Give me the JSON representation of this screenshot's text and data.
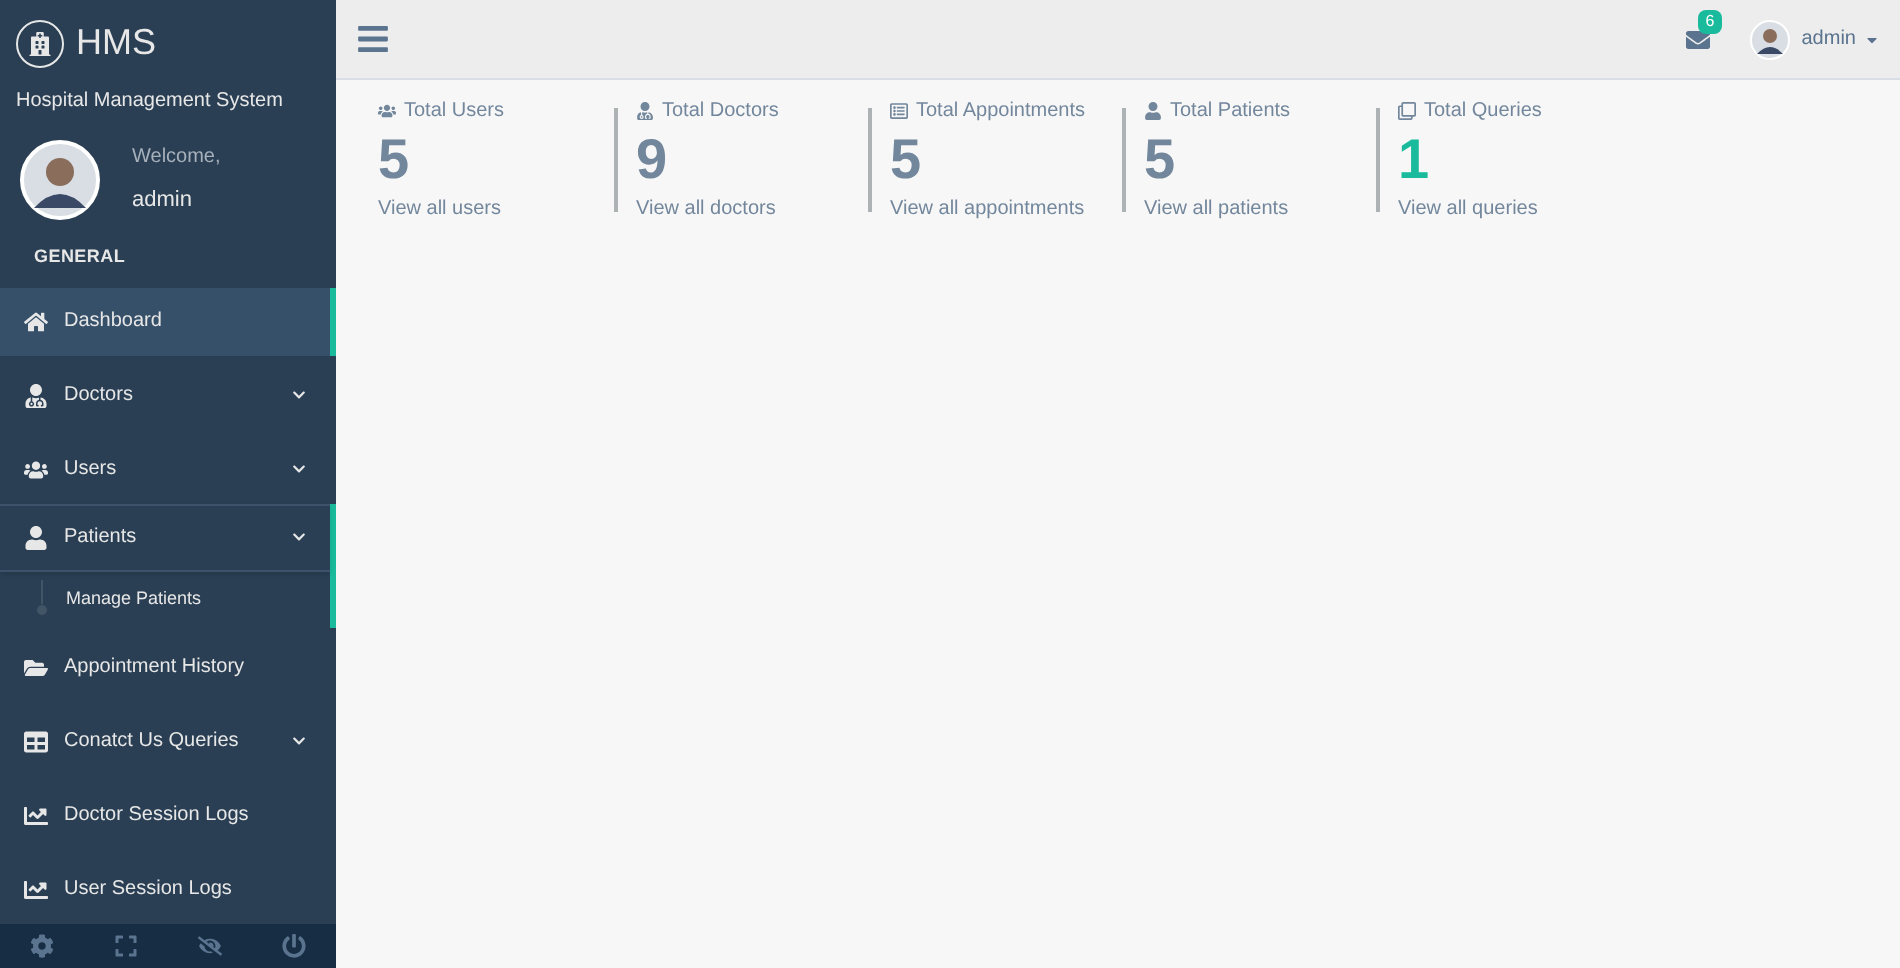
{
  "brand": {
    "title": "HMS",
    "subtitle": "Hospital Management System"
  },
  "profile": {
    "welcome": "Welcome,",
    "name": "admin"
  },
  "section_title": "GENERAL",
  "sidebar": {
    "items": [
      {
        "label": "Dashboard",
        "selected": true,
        "expandable": false,
        "expanded": false
      },
      {
        "label": "Doctors",
        "selected": false,
        "expandable": true,
        "expanded": false
      },
      {
        "label": "Users",
        "selected": false,
        "expandable": true,
        "expanded": false
      },
      {
        "label": "Patients",
        "selected": false,
        "expandable": true,
        "expanded": true,
        "children": [
          {
            "label": "Manage Patients"
          }
        ]
      },
      {
        "label": "Appointment History",
        "selected": false,
        "expandable": false,
        "expanded": false
      },
      {
        "label": "Conatct Us Queries",
        "selected": false,
        "expandable": true,
        "expanded": false
      },
      {
        "label": "Doctor Session Logs",
        "selected": false,
        "expandable": false,
        "expanded": false
      },
      {
        "label": "User Session Logs",
        "selected": false,
        "expandable": false,
        "expanded": false
      }
    ]
  },
  "topbar": {
    "mail_count": "6",
    "user": "admin"
  },
  "stats": [
    {
      "title": "Total Users",
      "value": "5",
      "link": "View all users",
      "color": "#73879c"
    },
    {
      "title": "Total Doctors",
      "value": "9",
      "link": "View all doctors",
      "color": "#73879c"
    },
    {
      "title": "Total Appointments",
      "value": "5",
      "link": "View all appointments",
      "color": "#73879c"
    },
    {
      "title": "Total Patients",
      "value": "5",
      "link": "View all patients",
      "color": "#73879c"
    },
    {
      "title": "Total Queries",
      "value": "1",
      "link": "View all queries",
      "color": "#1abb9c"
    }
  ]
}
